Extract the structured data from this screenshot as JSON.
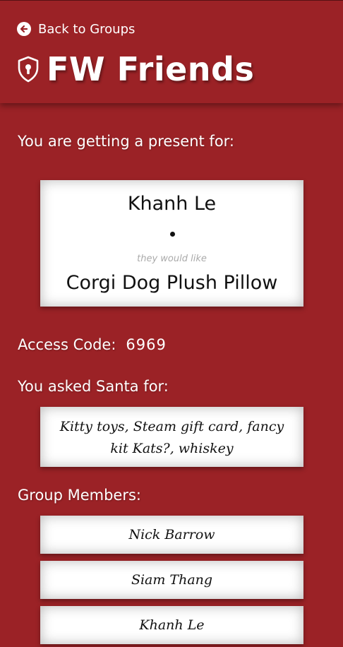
{
  "header": {
    "back_label": "Back to Groups",
    "group_name": "FW Friends"
  },
  "assignment": {
    "prompt": "You are getting a present for:",
    "recipient_name": "Khanh Le",
    "separator": "•",
    "would_like_label": "they would like",
    "gift": "Corgi Dog Plush Pillow"
  },
  "access": {
    "label": "Access Code:",
    "code": "6969"
  },
  "wishlist": {
    "label": "You asked Santa for:",
    "text": "Kitty toys, Steam gift card, fancy kit Kats?, whiskey"
  },
  "members": {
    "label": "Group Members:",
    "items": [
      "Nick Barrow",
      "Siam Thang",
      "Khanh Le"
    ]
  },
  "colors": {
    "background": "#9b2226",
    "card": "#ffffff"
  }
}
